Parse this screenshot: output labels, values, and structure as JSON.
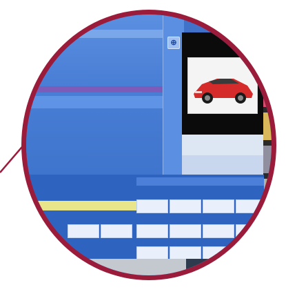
{
  "colors": {
    "lens_border": "#9b1c3a",
    "app_blue": "#4a7fd6",
    "accent_purple": "#7d5bb8",
    "highlight_yellow": "#e9e58a"
  },
  "mid_button": {
    "icon": "plus-icon",
    "glyph": "⊕"
  },
  "preview": {
    "image": "red-sports-car"
  },
  "thumbnails": [
    {
      "color": "#5aa6e2"
    },
    {
      "color": "#d94d6f"
    },
    {
      "color": "#d8b85a"
    },
    {
      "color": "#8f8fa0"
    },
    {
      "color": "#b7b09a"
    },
    {
      "color": "#1e1e1e"
    }
  ]
}
